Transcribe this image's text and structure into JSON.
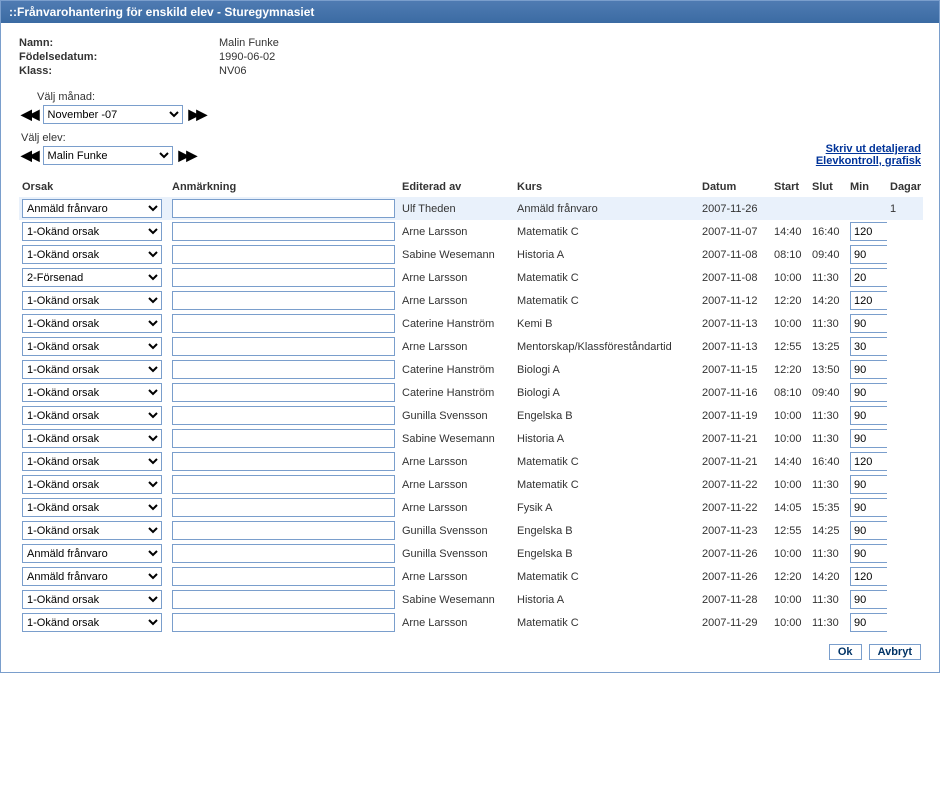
{
  "window": {
    "title": "::Frånvarohantering för enskild elev - Sturegymnasiet"
  },
  "student": {
    "name_label": "Namn:",
    "name": "Malin Funke",
    "dob_label": "Födelsedatum:",
    "dob": "1990-06-02",
    "class_label": "Klass:",
    "class": "NV06"
  },
  "selectors": {
    "month_label": "Välj månad:",
    "month_value": "November -07",
    "student_label": "Välj elev:",
    "student_value": "Malin Funke"
  },
  "links": {
    "print_detailed": "Skriv ut detaljerad",
    "graphic_control": "Elevkontroll, grafisk"
  },
  "headers": {
    "cause": "Orsak",
    "note": "Anmärkning",
    "editor": "Editerad av",
    "course": "Kurs",
    "date": "Datum",
    "start": "Start",
    "end": "Slut",
    "min": "Min",
    "days": "Dagar"
  },
  "buttons": {
    "ok": "Ok",
    "cancel": "Avbryt"
  },
  "rows": [
    {
      "cause": "Anmäld frånvaro",
      "note": "",
      "editor": "Ulf Theden",
      "course": "Anmäld frånvaro",
      "date": "2007-11-26",
      "start": "",
      "end": "",
      "min": "",
      "days": "1"
    },
    {
      "cause": "1-Okänd orsak",
      "note": "",
      "editor": "Arne Larsson",
      "course": "Matematik C",
      "date": "2007-11-07",
      "start": "14:40",
      "end": "16:40",
      "min": "120",
      "days": ""
    },
    {
      "cause": "1-Okänd orsak",
      "note": "",
      "editor": "Sabine Wesemann",
      "course": "Historia A",
      "date": "2007-11-08",
      "start": "08:10",
      "end": "09:40",
      "min": "90",
      "days": ""
    },
    {
      "cause": "2-Försenad",
      "note": "",
      "editor": "Arne Larsson",
      "course": "Matematik C",
      "date": "2007-11-08",
      "start": "10:00",
      "end": "11:30",
      "min": "20",
      "days": ""
    },
    {
      "cause": "1-Okänd orsak",
      "note": "",
      "editor": "Arne Larsson",
      "course": "Matematik C",
      "date": "2007-11-12",
      "start": "12:20",
      "end": "14:20",
      "min": "120",
      "days": ""
    },
    {
      "cause": "1-Okänd orsak",
      "note": "",
      "editor": "Caterine Hanström",
      "course": "Kemi B",
      "date": "2007-11-13",
      "start": "10:00",
      "end": "11:30",
      "min": "90",
      "days": ""
    },
    {
      "cause": "1-Okänd orsak",
      "note": "",
      "editor": "Arne Larsson",
      "course": "Mentorskap/Klassföreståndartid",
      "date": "2007-11-13",
      "start": "12:55",
      "end": "13:25",
      "min": "30",
      "days": ""
    },
    {
      "cause": "1-Okänd orsak",
      "note": "",
      "editor": "Caterine Hanström",
      "course": "Biologi A",
      "date": "2007-11-15",
      "start": "12:20",
      "end": "13:50",
      "min": "90",
      "days": ""
    },
    {
      "cause": "1-Okänd orsak",
      "note": "",
      "editor": "Caterine Hanström",
      "course": "Biologi A",
      "date": "2007-11-16",
      "start": "08:10",
      "end": "09:40",
      "min": "90",
      "days": ""
    },
    {
      "cause": "1-Okänd orsak",
      "note": "",
      "editor": "Gunilla Svensson",
      "course": "Engelska B",
      "date": "2007-11-19",
      "start": "10:00",
      "end": "11:30",
      "min": "90",
      "days": ""
    },
    {
      "cause": "1-Okänd orsak",
      "note": "",
      "editor": "Sabine Wesemann",
      "course": "Historia A",
      "date": "2007-11-21",
      "start": "10:00",
      "end": "11:30",
      "min": "90",
      "days": ""
    },
    {
      "cause": "1-Okänd orsak",
      "note": "",
      "editor": "Arne Larsson",
      "course": "Matematik C",
      "date": "2007-11-21",
      "start": "14:40",
      "end": "16:40",
      "min": "120",
      "days": ""
    },
    {
      "cause": "1-Okänd orsak",
      "note": "",
      "editor": "Arne Larsson",
      "course": "Matematik C",
      "date": "2007-11-22",
      "start": "10:00",
      "end": "11:30",
      "min": "90",
      "days": ""
    },
    {
      "cause": "1-Okänd orsak",
      "note": "",
      "editor": "Arne Larsson",
      "course": "Fysik A",
      "date": "2007-11-22",
      "start": "14:05",
      "end": "15:35",
      "min": "90",
      "days": ""
    },
    {
      "cause": "1-Okänd orsak",
      "note": "",
      "editor": "Gunilla Svensson",
      "course": "Engelska B",
      "date": "2007-11-23",
      "start": "12:55",
      "end": "14:25",
      "min": "90",
      "days": ""
    },
    {
      "cause": "Anmäld frånvaro",
      "note": "",
      "editor": "Gunilla Svensson",
      "course": "Engelska B",
      "date": "2007-11-26",
      "start": "10:00",
      "end": "11:30",
      "min": "90",
      "days": ""
    },
    {
      "cause": "Anmäld frånvaro",
      "note": "",
      "editor": "Arne Larsson",
      "course": "Matematik C",
      "date": "2007-11-26",
      "start": "12:20",
      "end": "14:20",
      "min": "120",
      "days": ""
    },
    {
      "cause": "1-Okänd orsak",
      "note": "",
      "editor": "Sabine Wesemann",
      "course": "Historia A",
      "date": "2007-11-28",
      "start": "10:00",
      "end": "11:30",
      "min": "90",
      "days": ""
    },
    {
      "cause": "1-Okänd orsak",
      "note": "",
      "editor": "Arne Larsson",
      "course": "Matematik C",
      "date": "2007-11-29",
      "start": "10:00",
      "end": "11:30",
      "min": "90",
      "days": ""
    }
  ]
}
